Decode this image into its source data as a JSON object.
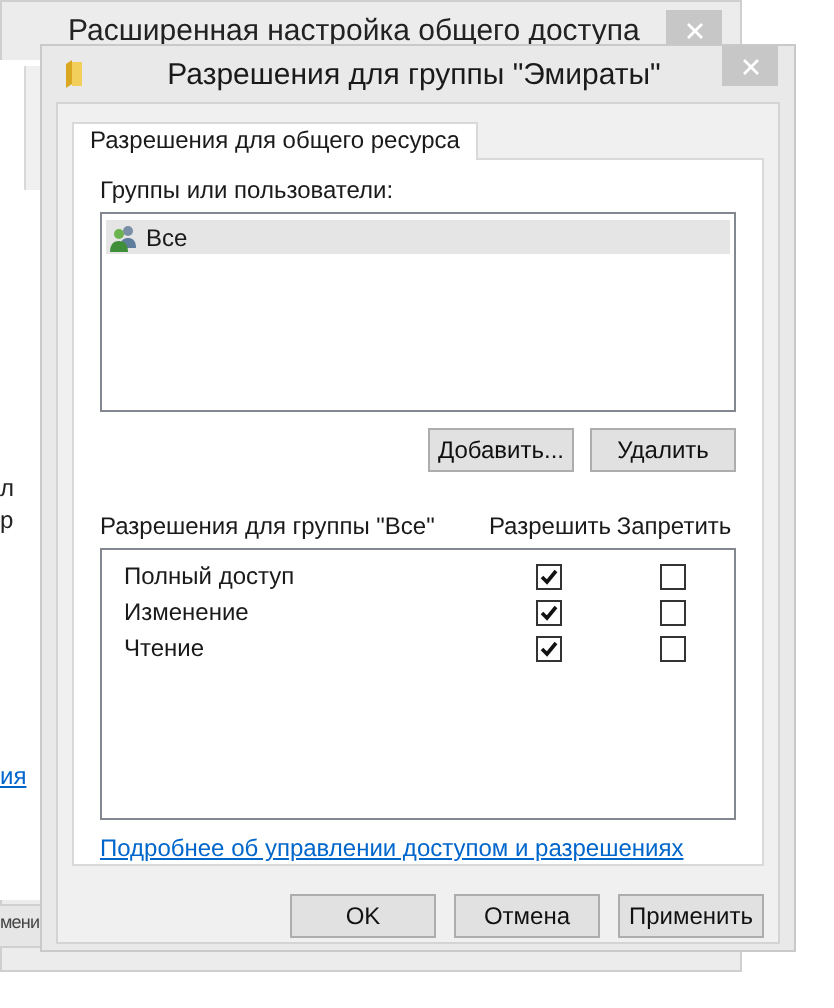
{
  "background_window": {
    "title": "Расширенная настройка общего доступа",
    "side_texts": [
      "л",
      "р"
    ],
    "link": "ия",
    "button": "мени"
  },
  "dialog": {
    "title": "Разрешения для группы \"Эмираты\"",
    "tabs": [
      {
        "label": "Разрешения для общего ресурса",
        "selected": true
      }
    ],
    "groups_label": "Группы или пользователи:",
    "principals": [
      {
        "name": "Все",
        "selected": true
      }
    ],
    "buttons": [
      "Добавить...",
      "Удалить"
    ],
    "permissions_label": "Разрешения для группы \"Все\"",
    "columns": [
      "Разрешить",
      "Запретить"
    ],
    "permissions": [
      {
        "name": "Полный доступ",
        "allow": true,
        "deny": false
      },
      {
        "name": "Изменение",
        "allow": true,
        "deny": false
      },
      {
        "name": "Чтение",
        "allow": true,
        "deny": false
      }
    ],
    "link": "Подробнее об управлении доступом и разрешениях",
    "footer_buttons": [
      "OK",
      "Отмена",
      "Применить"
    ]
  }
}
